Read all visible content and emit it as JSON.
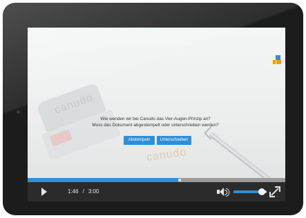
{
  "video": {
    "question_line1": "Wie wenden wir bei Canudo das Vier-Augen-Prinzip an?",
    "question_line2": "Muss das Dokument abgestempelt oder unterschrieben werden?",
    "choices": [
      "Abstempeln",
      "Unterschreiben"
    ],
    "stamp_logo_text": "canudo",
    "stamp_print_text": "canudo"
  },
  "player": {
    "current_time": "1:46",
    "separator": "/",
    "duration": "3:00",
    "progress_fraction": 0.59,
    "volume_fraction": 0.85,
    "accent_color": "#2f8fd6",
    "icons": {
      "play": "play-icon",
      "volume": "volume-icon",
      "fullscreen": "fullscreen-icon"
    }
  },
  "colors": {
    "bezel": "#1c1c1c",
    "control_bar": "#2b2b2b",
    "brand_blue": "#2f8fd6",
    "brand_orange": "#f39c12"
  }
}
